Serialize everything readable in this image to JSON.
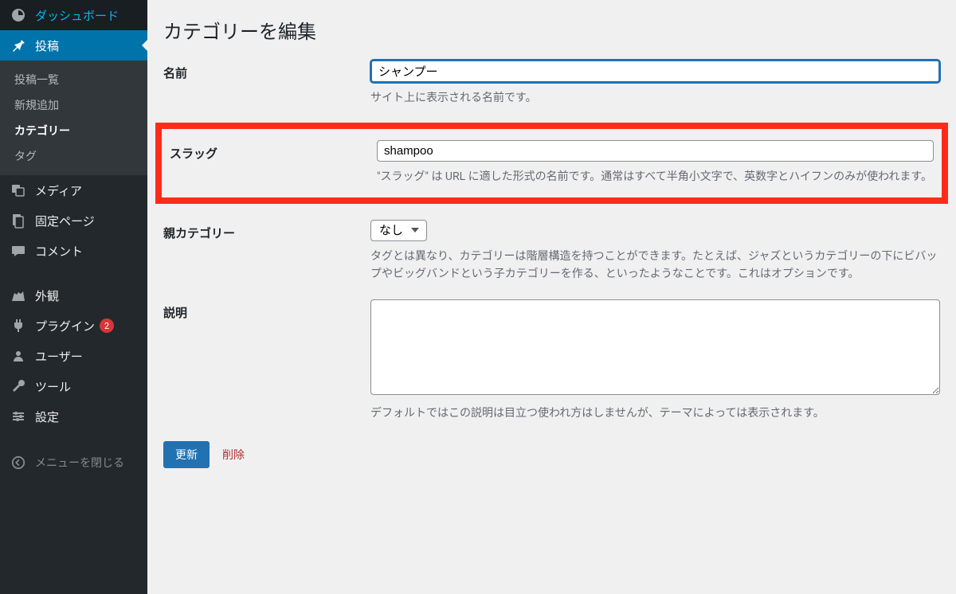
{
  "sidebar": {
    "items": [
      {
        "label": "ダッシュボード",
        "icon": "dashboard"
      },
      {
        "label": "投稿",
        "icon": "pin",
        "active": true,
        "submenu": [
          {
            "label": "投稿一覧"
          },
          {
            "label": "新規追加"
          },
          {
            "label": "カテゴリー",
            "current": true
          },
          {
            "label": "タグ"
          }
        ]
      },
      {
        "label": "メディア",
        "icon": "media"
      },
      {
        "label": "固定ページ",
        "icon": "pages"
      },
      {
        "label": "コメント",
        "icon": "comment"
      },
      {
        "label": "外観",
        "icon": "appearance"
      },
      {
        "label": "プラグイン",
        "icon": "plugins",
        "badge": "2"
      },
      {
        "label": "ユーザー",
        "icon": "users"
      },
      {
        "label": "ツール",
        "icon": "tools"
      },
      {
        "label": "設定",
        "icon": "settings"
      }
    ],
    "collapse_label": "メニューを閉じる"
  },
  "page": {
    "title": "カテゴリーを編集"
  },
  "form": {
    "name": {
      "label": "名前",
      "value": "シャンプー",
      "description": "サイト上に表示される名前です。"
    },
    "slug": {
      "label": "スラッグ",
      "value": "shampoo",
      "description": "\"スラッグ\" は URL に適した形式の名前です。通常はすべて半角小文字で、英数字とハイフンのみが使われます。"
    },
    "parent": {
      "label": "親カテゴリー",
      "selected": "なし",
      "description": "タグとは異なり、カテゴリーは階層構造を持つことができます。たとえば、ジャズというカテゴリーの下にビバップやビッグバンドという子カテゴリーを作る、といったようなことです。これはオプションです。"
    },
    "description": {
      "label": "説明",
      "value": "",
      "description": "デフォルトではこの説明は目立つ使われ方はしませんが、テーマによっては表示されます。"
    }
  },
  "actions": {
    "submit_label": "更新",
    "delete_label": "削除"
  }
}
